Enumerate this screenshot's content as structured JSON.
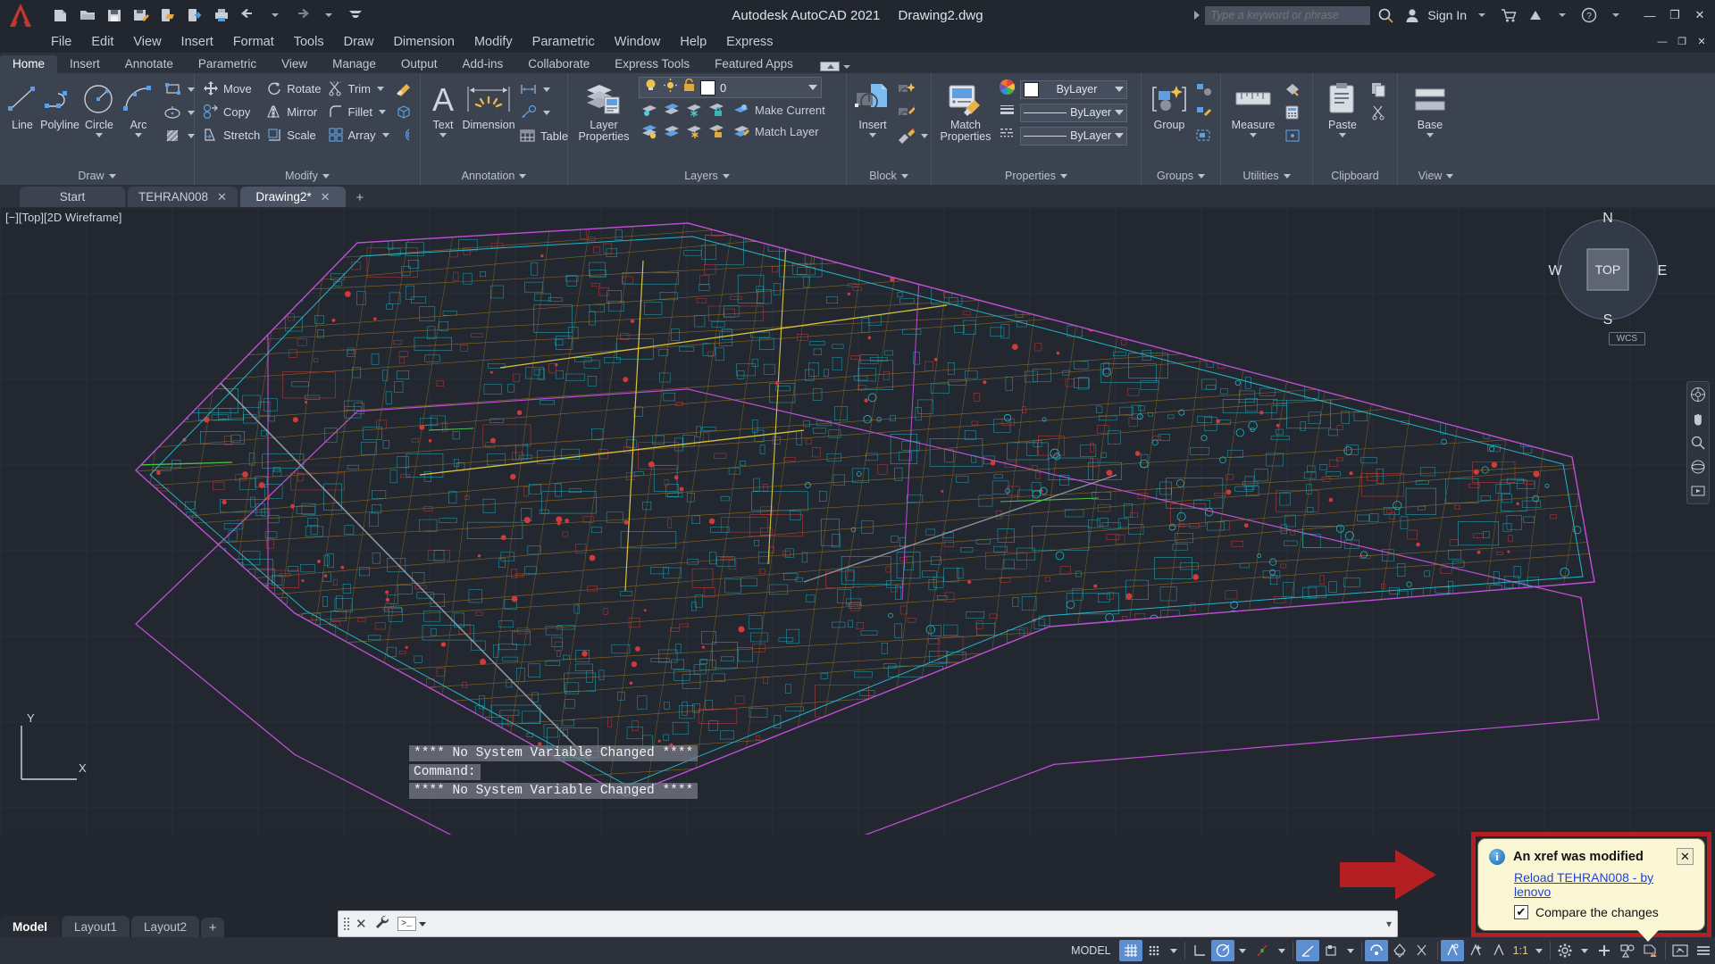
{
  "titlebar": {
    "app_title": "Autodesk AutoCAD 2021",
    "document_title": "Drawing2.dwg",
    "search_placeholder": "Type a keyword or phrase",
    "search_value": "",
    "sign_in": "Sign In",
    "quick_access": [
      {
        "name": "new-icon"
      },
      {
        "name": "open-icon"
      },
      {
        "name": "save-icon"
      },
      {
        "name": "save-as-icon"
      },
      {
        "name": "open-from-web-icon"
      },
      {
        "name": "plot-icon"
      },
      {
        "name": "undo-icon"
      },
      {
        "name": "redo-icon"
      },
      {
        "name": "customize-qat-icon"
      }
    ],
    "window_buttons": {
      "minimize": "—",
      "maximize": "❐",
      "close": "✕"
    }
  },
  "menubar": {
    "items": [
      "File",
      "Edit",
      "View",
      "Insert",
      "Format",
      "Tools",
      "Draw",
      "Dimension",
      "Modify",
      "Parametric",
      "Window",
      "Help",
      "Express"
    ],
    "window_buttons": {
      "minimize": "—",
      "restore": "❐",
      "close": "✕"
    }
  },
  "ribbon": {
    "tabs": [
      "Home",
      "Insert",
      "Annotate",
      "Parametric",
      "View",
      "Manage",
      "Output",
      "Add-ins",
      "Collaborate",
      "Express Tools",
      "Featured Apps"
    ],
    "active_tab": "Home",
    "panels": {
      "draw": {
        "title": "Draw",
        "big": [
          {
            "label": "Line",
            "icon": "line-icon",
            "dropdown": false
          },
          {
            "label": "Polyline",
            "icon": "polyline-icon",
            "dropdown": false
          },
          {
            "label": "Circle",
            "icon": "circle-icon",
            "dropdown": true
          },
          {
            "label": "Arc",
            "icon": "arc-icon",
            "dropdown": true
          }
        ],
        "small": [
          {
            "icon": "rectangle-icon"
          },
          {
            "icon": "ellipse-icon"
          },
          {
            "icon": "hatch-icon"
          }
        ]
      },
      "modify": {
        "title": "Modify",
        "col1": [
          {
            "label": "Move",
            "icon": "move-icon"
          },
          {
            "label": "Copy",
            "icon": "copy-icon"
          },
          {
            "label": "Stretch",
            "icon": "stretch-icon"
          }
        ],
        "col2": [
          {
            "label": "Rotate",
            "icon": "rotate-icon"
          },
          {
            "label": "Mirror",
            "icon": "mirror-icon"
          },
          {
            "label": "Scale",
            "icon": "scale-icon"
          }
        ],
        "col3": [
          {
            "label": "Trim",
            "icon": "trim-icon",
            "dropdown": true
          },
          {
            "label": "Fillet",
            "icon": "fillet-icon",
            "dropdown": true
          },
          {
            "label": "Array",
            "icon": "array-icon",
            "dropdown": true
          }
        ],
        "col4": [
          {
            "icon": "erase-icon"
          },
          {
            "icon": "explode-icon"
          },
          {
            "icon": "offset-icon"
          }
        ]
      },
      "annotation": {
        "title": "Annotation",
        "big": [
          {
            "label": "Text",
            "icon": "text-icon",
            "dropdown": true
          },
          {
            "label": "Dimension",
            "icon": "dimension-icon",
            "dropdown": false
          }
        ],
        "small": [
          {
            "icon": "dimension-style-icon",
            "dropdown": true
          },
          {
            "icon": "leader-icon",
            "dropdown": true
          },
          {
            "label": "Table",
            "icon": "table-icon"
          }
        ]
      },
      "layers": {
        "title": "Layers",
        "big": {
          "label": "Layer\nProperties",
          "label_line1": "Layer",
          "label_line2": "Properties",
          "icon": "layer-properties-icon"
        },
        "current_layer": "0",
        "row_buttons": [
          {
            "label": "Make Current",
            "icon": "make-current-icon"
          },
          {
            "label": "Match Layer",
            "icon": "match-layer-icon"
          }
        ]
      },
      "block": {
        "title": "Block",
        "big": {
          "label": "Insert",
          "icon": "insert-block-icon",
          "dropdown": true
        },
        "small": [
          {
            "icon": "create-block-icon"
          },
          {
            "icon": "edit-block-icon"
          },
          {
            "icon": "edit-attribute-icon",
            "dropdown": true
          }
        ]
      },
      "properties": {
        "title": "Properties",
        "big": {
          "label_line1": "Match",
          "label_line2": "Properties",
          "icon": "match-properties-icon"
        },
        "rows": [
          {
            "icon": "color-wheel-icon",
            "value": "ByLayer",
            "type": "color"
          },
          {
            "icon": "lineweight-icon",
            "value": "ByLayer",
            "type": "lineweight"
          },
          {
            "icon": "linetype-icon",
            "value": "ByLayer",
            "type": "linetype"
          }
        ]
      },
      "groups": {
        "title": "Groups",
        "big": {
          "label": "Group",
          "icon": "group-icon"
        },
        "small": [
          {
            "icon": "ungroup-icon"
          },
          {
            "icon": "group-edit-icon"
          },
          {
            "icon": "group-selection-icon"
          }
        ]
      },
      "utilities": {
        "title": "Utilities",
        "big": {
          "label": "Measure",
          "icon": "measure-icon",
          "dropdown": true
        },
        "small": [
          {
            "icon": "quick-select-icon"
          },
          {
            "icon": "quick-calc-icon"
          },
          {
            "icon": "point-style-icon"
          }
        ]
      },
      "clipboard": {
        "title": "Clipboard",
        "big": {
          "label": "Paste",
          "icon": "paste-icon",
          "dropdown": true
        },
        "small": [
          {
            "icon": "copy-clip-icon"
          },
          {
            "icon": "cut-clip-icon"
          }
        ]
      },
      "view": {
        "title": "View",
        "big": {
          "label": "Base",
          "icon": "base-view-icon",
          "dropdown": true
        }
      }
    }
  },
  "file_tabs": {
    "tabs": [
      {
        "label": "Start",
        "closable": false,
        "active": false
      },
      {
        "label": "TEHRAN008",
        "closable": true,
        "active": false
      },
      {
        "label": "Drawing2*",
        "closable": true,
        "active": true
      }
    ],
    "new_tab": "+"
  },
  "canvas": {
    "viewport_label_minus": "[−]",
    "viewport_label_view": "[Top]",
    "viewport_label_style": "[2D Wireframe]",
    "viewcube": {
      "top": "TOP",
      "north": "N",
      "south": "S",
      "east": "E",
      "west": "W"
    },
    "wcs_label": "WCS",
    "ucs_x": "X",
    "ucs_y": "Y"
  },
  "command_history": [
    "**** No System Variable Changed ****",
    "Command:",
    "**** No System Variable Changed ****"
  ],
  "command_line": {
    "value": "",
    "placeholder": "",
    "close_icon": "✕",
    "tools_icon": "wrench-icon"
  },
  "balloon": {
    "title": "An xref was modified",
    "link": "Reload TEHRAN008 - by lenovo",
    "checkbox_label": "Compare the changes",
    "checkbox_checked": true,
    "close": "✕",
    "info_glyph": "i",
    "check_glyph": "✔",
    "highlight_color": "#b41f24",
    "background_color": "#fbf7d5"
  },
  "layout_tabs": {
    "tabs": [
      "Model",
      "Layout1",
      "Layout2"
    ],
    "active": "Model",
    "add": "+"
  },
  "statusbar": {
    "model_label": "MODEL",
    "scale": "1:1",
    "buttons": [
      {
        "name": "grid-display-button",
        "on": true
      },
      {
        "name": "snap-mode-button",
        "on": false
      },
      {
        "name": "ortho-mode-button",
        "on": false
      },
      {
        "name": "polar-tracking-button",
        "on": true
      },
      {
        "name": "isometric-drafting-button",
        "on": false
      },
      {
        "name": "object-snap-tracking-button",
        "on": true
      },
      {
        "name": "object-snap-button",
        "on": true
      },
      {
        "name": "lineweight-button",
        "on": false
      },
      {
        "name": "transparency-button",
        "on": false
      },
      {
        "name": "selection-cycling-button",
        "on": true
      },
      {
        "name": "3d-object-snap-button",
        "on": false
      },
      {
        "name": "dynamic-ucs-button",
        "on": false
      },
      {
        "name": "annotation-visibility-button",
        "on": false
      },
      {
        "name": "autoscale-button",
        "on": false
      },
      {
        "name": "workspace-switching-button",
        "on": false
      },
      {
        "name": "add-tools-button",
        "on": false
      },
      {
        "name": "isolate-objects-button",
        "on": false
      },
      {
        "name": "hardware-acceleration-button",
        "on": false
      },
      {
        "name": "clean-screen-button",
        "on": false
      },
      {
        "name": "customization-button",
        "on": false
      }
    ]
  },
  "colors": {
    "titlebar_bg": "#22262e",
    "ribbon_bg": "#3b4250",
    "canvas_bg": "#23272f",
    "accent_blue": "#5d8fd0",
    "highlight_red": "#b41f24",
    "balloon_yellow": "#fbf7d5"
  }
}
